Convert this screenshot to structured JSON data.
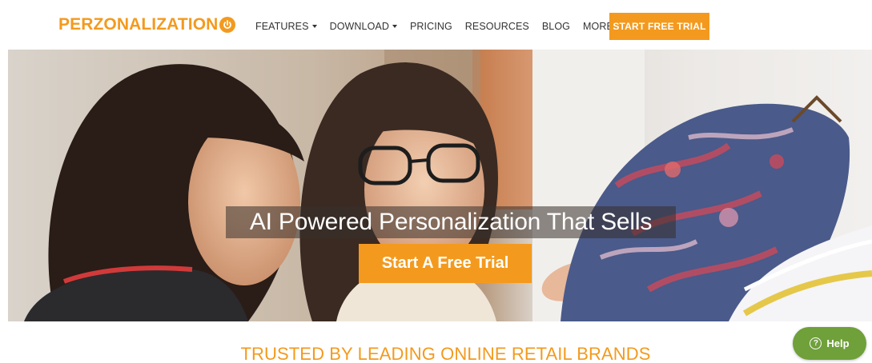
{
  "header": {
    "logo_text": "PERZONALIZATION",
    "logo_icon": "power-icon",
    "nav": [
      {
        "label": "FEATURES",
        "dropdown": true
      },
      {
        "label": "DOWNLOAD",
        "dropdown": true
      },
      {
        "label": "PRICING",
        "dropdown": false
      },
      {
        "label": "RESOURCES",
        "dropdown": false
      },
      {
        "label": "BLOG",
        "dropdown": false
      },
      {
        "label": "MORE",
        "dropdown": true
      }
    ],
    "cta_label": "START FREE TRIAL"
  },
  "hero": {
    "title": "AI Powered Personalization That Sells",
    "cta_label": "Start A Free Trial"
  },
  "trusted": {
    "heading": "TRUSTED BY LEADING ONLINE RETAIL BRANDS"
  },
  "help": {
    "label": "Help",
    "icon": "question-icon"
  },
  "colors": {
    "brand_orange": "#f39a1e",
    "help_green": "#6fa03a"
  }
}
